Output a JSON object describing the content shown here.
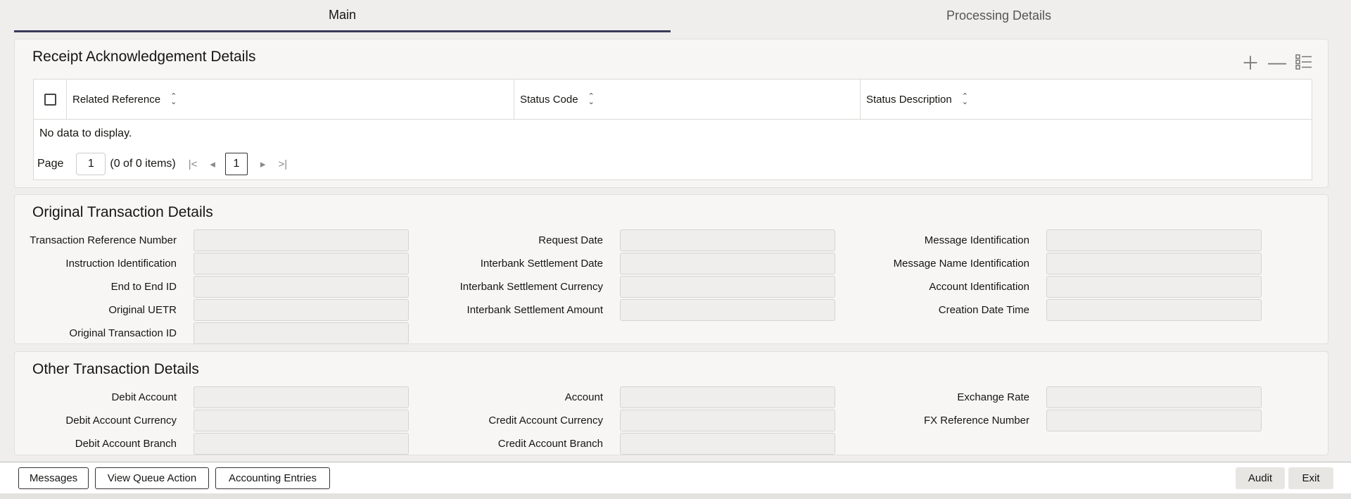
{
  "tabs": {
    "main": "Main",
    "processing": "Processing Details"
  },
  "receipt": {
    "title": "Receipt Acknowledgement Details",
    "columns": [
      "Related Reference",
      "Status Code",
      "Status Description"
    ],
    "no_data": "No data to display.",
    "pager": {
      "label": "Page",
      "value": "1",
      "count": "(0 of 0 items)",
      "current": "1"
    }
  },
  "original": {
    "title": "Original Transaction Details",
    "col1": [
      "Transaction Reference Number",
      "Instruction Identification",
      "End to End ID",
      "Original UETR",
      "Original Transaction ID"
    ],
    "col2": [
      "Request Date",
      "Interbank Settlement Date",
      "Interbank Settlement Currency",
      "Interbank Settlement Amount"
    ],
    "col3": [
      "Message Identification",
      "Message Name Identification",
      "Account Identification",
      "Creation Date Time"
    ]
  },
  "other": {
    "title": "Other Transaction Details",
    "col1": [
      "Debit Account",
      "Debit Account Currency",
      "Debit Account Branch"
    ],
    "col2": [
      "Account",
      "Credit Account Currency",
      "Credit Account Branch"
    ],
    "col3": [
      "Exchange Rate",
      "FX Reference Number"
    ]
  },
  "footer": {
    "messages": "Messages",
    "view_queue": "View Queue Action",
    "accounting": "Accounting Entries",
    "audit": "Audit",
    "exit": "Exit"
  },
  "icons": {
    "add": "plus-icon",
    "remove": "minus-icon",
    "columns": "list-columns-icon"
  }
}
